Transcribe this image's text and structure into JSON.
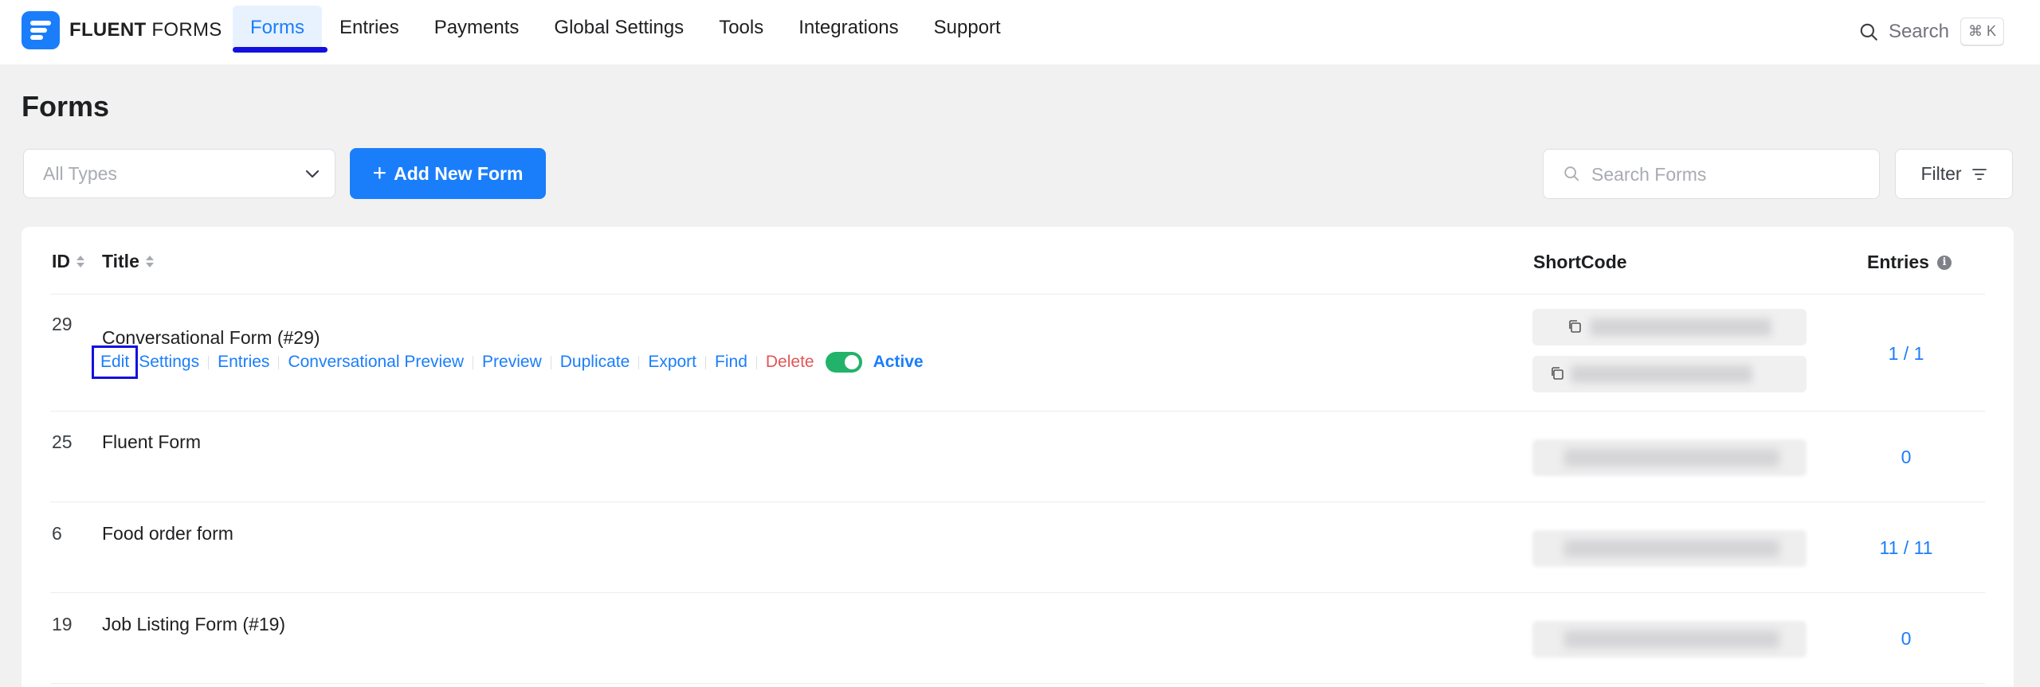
{
  "brand": {
    "name_bold": "FLUENT",
    "name_light": "FORMS"
  },
  "nav": {
    "items": [
      {
        "label": "Forms",
        "active": true
      },
      {
        "label": "Entries"
      },
      {
        "label": "Payments"
      },
      {
        "label": "Global Settings"
      },
      {
        "label": "Tools"
      },
      {
        "label": "Integrations"
      },
      {
        "label": "Support"
      }
    ],
    "search_label": "Search",
    "search_shortcut": "⌘ K"
  },
  "page": {
    "title": "Forms"
  },
  "toolbar": {
    "type_placeholder": "All Types",
    "add_label": "Add New Form",
    "search_placeholder": "Search Forms",
    "filter_label": "Filter"
  },
  "table": {
    "headers": {
      "id": "ID",
      "title": "Title",
      "shortcode": "ShortCode",
      "entries": "Entries"
    },
    "row_actions": [
      "Edit",
      "Settings",
      "Entries",
      "Conversational Preview",
      "Preview",
      "Duplicate",
      "Export",
      "Find",
      "Delete"
    ],
    "status_label": "Active",
    "rows": [
      {
        "id": "29",
        "title": "Conversational Form (#29)",
        "entries": "1 / 1"
      },
      {
        "id": "25",
        "title": "Fluent Form",
        "entries": "0"
      },
      {
        "id": "6",
        "title": "Food order form",
        "entries": "11 / 11"
      },
      {
        "id": "19",
        "title": "Job Listing Form (#19)",
        "entries": "0"
      }
    ]
  },
  "colors": {
    "primary": "#1a7efb",
    "danger": "#e05757",
    "toggle_on": "#21b36a",
    "highlight_box": "#1310dd"
  }
}
